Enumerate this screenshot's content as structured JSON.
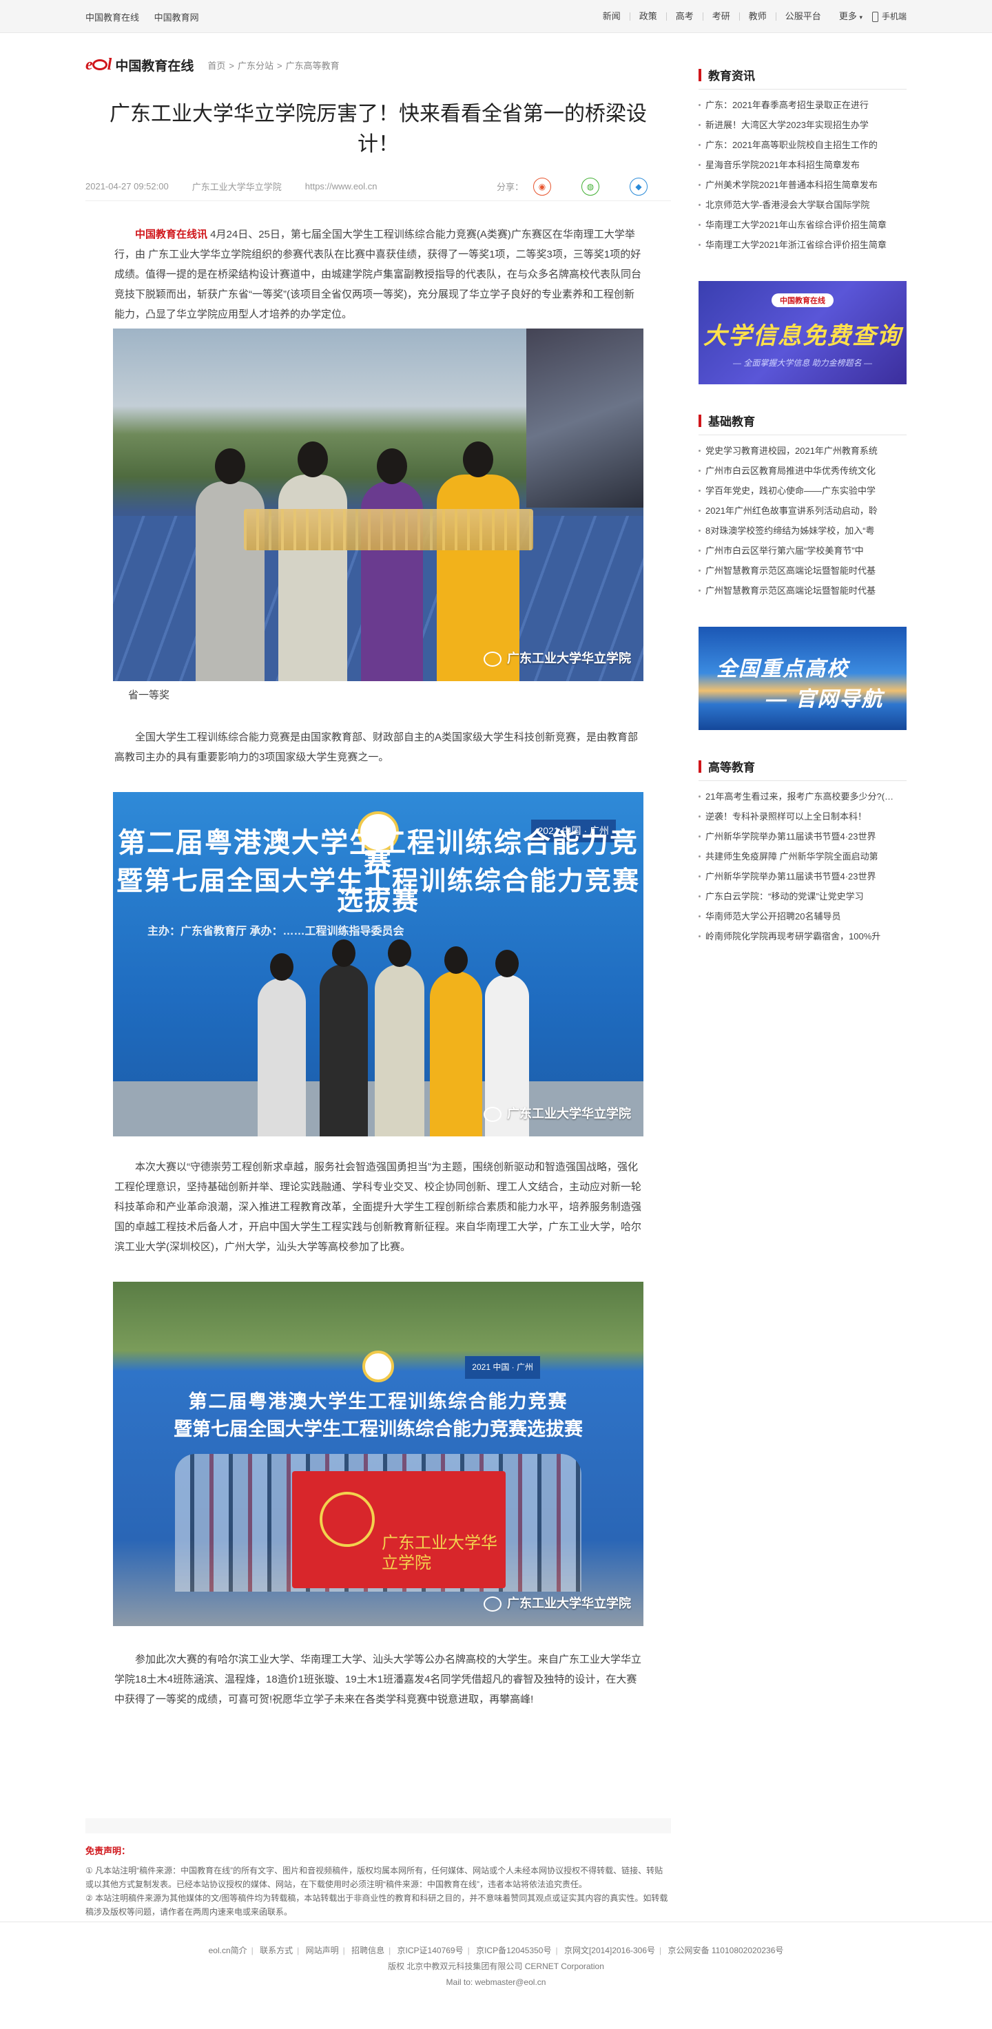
{
  "topbar": {
    "left": [
      "中国教育在线",
      "中国教育网"
    ],
    "nav": [
      "新闻",
      "政策",
      "高考",
      "考研",
      "教师",
      "公服平台"
    ],
    "more": "更多",
    "mobile": "手机端"
  },
  "logo": {
    "eol": "eol",
    "name": "中国教育在线"
  },
  "breadcrumb": [
    "首页",
    "广东分站",
    "广东高等教育"
  ],
  "article": {
    "title": "广东工业大学华立学院厉害了！快来看看全省第一的桥梁设计！",
    "date": "2021-04-27 09:52:00",
    "author": "广东工业大学华立学院",
    "source_url": "https://www.eol.cn",
    "share_label": "分享：",
    "source_name": "中国教育在线讯",
    "p1": " 4月24日、25日，第七届全国大学生工程训练综合能力竞赛(A类赛)广东赛区在华南理工大学举行，由 广东工业大学华立学院组织的参赛代表队在比赛中喜获佳绩，获得了一等奖1项，二等奖3项，三等奖1项的好成绩。值得一提的是在桥梁结构设计赛道中，由城建学院卢集富副教授指导的代表队，在与众多名牌高校代表队同台竞技下脱颖而出，斩获广东省“一等奖”(该项目全省仅两项一等奖)，充分展现了华立学子良好的专业素养和工程创新能力，凸显了华立学院应用型人才培养的办学定位。",
    "caption1": "省一等奖",
    "p2": "全国大学生工程训练综合能力竞赛是由国家教育部、财政部自主的A类国家级大学生科技创新竞赛，是由教育部高教司主办的具有重要影响力的3项国家级大学生竞赛之一。",
    "p3": "本次大赛以“守德崇劳工程创新求卓越，服务社会智造强国勇担当”为主题，围绕创新驱动和智造强国战略，强化工程伦理意识，坚持基础创新并举、理论实践融通、学科专业交叉、校企协同创新、理工人文结合，主动应对新一轮科技革命和产业革命浪潮，深入推进工程教育改革，全面提升大学生工程创新综合素质和能力水平，培养服务制造强国的卓越工程技术后备人才，开启中国大学生工程实践与创新教育新征程。来自华南理工大学，广东工业大学，哈尔滨工业大学(深圳校区)，广州大学，汕头大学等高校参加了比赛。",
    "p4": "参加此次大赛的有哈尔滨工业大学、华南理工大学、汕头大学等公办名牌高校的大学生。来自广东工业大学华立学院18土木4班陈涵滨、温程烽，18造价1班张璇、19土木1班潘嘉发4名同学凭借超凡的睿智及独特的设计，在大赛中获得了一等奖的成绩，可喜可贺!祝愿华立学子未来在各类学科竞赛中锐意进取，再攀高峰!",
    "watermark": "广东工业大学华立学院",
    "banner_line1": "第二届粤港澳大学生工程训练综合能力竞赛",
    "banner_line2": "暨第七届全国大学生工程训练综合能力竞赛选拔赛",
    "banner_year": "2021 中国 · 广州",
    "banner_sub": "主办：广东省教育厅  承办：……工程训练指导委员会",
    "flag_text": "广东工业大学华立学院"
  },
  "sidebar": {
    "sections": [
      {
        "title": "教育资讯",
        "items": [
          "广东：2021年春季高考招生录取正在进行",
          "新进展！大湾区大学2023年实现招生办学",
          "广东：2021年高等职业院校自主招生工作的",
          "星海音乐学院2021年本科招生简章发布",
          "广州美术学院2021年普通本科招生简章发布",
          "北京师范大学-香港浸会大学联合国际学院",
          "华南理工大学2021年山东省综合评价招生简章",
          "华南理工大学2021年浙江省综合评价招生简章"
        ]
      },
      {
        "title": "基础教育",
        "items": [
          "党史学习教育进校园，2021年广州教育系统",
          "广州市白云区教育局推进中华优秀传统文化",
          "学百年党史，践初心使命——广东实验中学",
          "2021年广州红色故事宣讲系列活动启动，聆",
          "8对珠澳学校签约缔结为姊妹学校，加入“粤",
          "广州市白云区举行第六届“学校美育节”中",
          "广州智慧教育示范区高端论坛暨智能时代基",
          "广州智慧教育示范区高端论坛暨智能时代基"
        ]
      },
      {
        "title": "高等教育",
        "items": [
          "21年高考生看过来，报考广东高校要多少分?(…",
          "逆袭！专科补录照样可以上全日制本科！",
          "广州新华学院举办第11届读书节暨4·23世界",
          "共建师生免疫屏障 广州新华学院全面启动第",
          "广州新华学院举办第11届读书节暨4·23世界",
          "广东白云学院：“移动的党课”让党史学习",
          "华南师范大学公开招聘20名辅导员",
          "岭南师院化学院再现考研学霸宿舍，100%升"
        ]
      }
    ],
    "ad1": {
      "logo": "中国教育在线",
      "big": "大学信息免费查询",
      "small": "— 全面掌握大学信息  助力金榜题名 —"
    },
    "ad2": {
      "line1": "全国重点高校",
      "line2": "— 官网导航"
    }
  },
  "disclaimer": {
    "title": "免责声明：",
    "lines": [
      "① 凡本站注明“稿件来源：中国教育在线”的所有文字、图片和音视频稿件，版权均属本网所有，任何媒体、网站或个人未经本网协议授权不得转载、链接、转贴或以其他方式复制发表。已经本站协议授权的媒体、网站，在下载使用时必须注明“稿件来源：中国教育在线”，违者本站将依法追究责任。",
      "② 本站注明稿件来源为其他媒体的文/图等稿件均为转载稿，本站转载出于非商业性的教育和科研之目的，并不意味着赞同其观点或证实其内容的真实性。如转载稿涉及版权等问题，请作者在两周内速来电或来函联系。"
    ]
  },
  "footer": {
    "links": [
      "eol.cn简介",
      "联系方式",
      "网站声明",
      "招聘信息",
      "京ICP证140769号",
      "京ICP备12045350号",
      "京网文[2014]2016-306号",
      "京公网安备 11010802020236号"
    ],
    "copyright": "版权  北京中教双元科技集团有限公司  CERNET Corporation",
    "mail": "Mail to: webmaster@eol.cn"
  }
}
